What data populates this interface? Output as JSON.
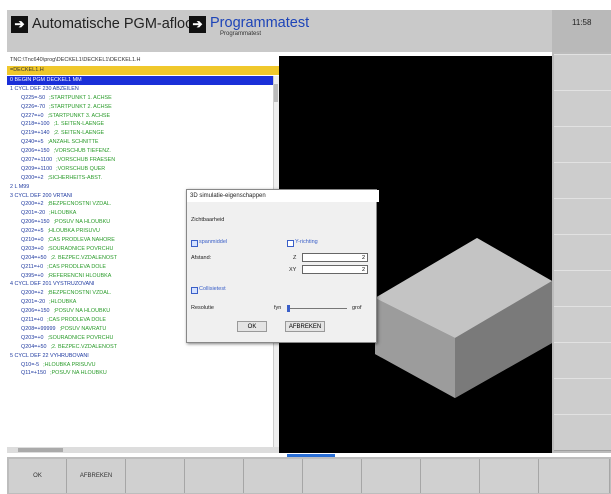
{
  "header": {
    "mode_title": "Automatische PGM-afloop",
    "program_title": "Programmatest",
    "program_sub": "Programmatest",
    "mode_icon": "play-arrow-icon",
    "program_icon": "play-arrow-icon",
    "time": "11:58"
  },
  "program": {
    "path": "TNC:\\Tnc640\\prog\\DECKEL1\\DECKEL1\\DECKEL1.H",
    "file_tab": "=DECKEL1.H",
    "lines": [
      {
        "num": "0",
        "text": "BEGIN PGM DECKEL1 MM",
        "hl": true
      },
      {
        "num": "1",
        "text": "CYCL DEF 230 ABZEILEN"
      },
      {
        "prm": "Q225=-50",
        "cmt": ";STARTPUNKT 1. ACHSE"
      },
      {
        "prm": "Q226=-70",
        "cmt": ";STARTPUNKT 2. ACHSE"
      },
      {
        "prm": "Q227=+0",
        "cmt": ";STARTPUNKT 3. ACHSE"
      },
      {
        "prm": "Q218=+100",
        "cmt": ";1. SEITEN-LAENGE"
      },
      {
        "prm": "Q219=+140",
        "cmt": ";2. SEITEN-LAENGE"
      },
      {
        "prm": "Q240=+5",
        "cmt": ";ANZAHL SCHNITTE"
      },
      {
        "prm": "Q206=+150",
        "cmt": ";VORSCHUB TIEFENZ."
      },
      {
        "prm": "Q207=+1100",
        "cmt": ";VORSCHUB FRAESEN"
      },
      {
        "prm": "Q209=+1100",
        "cmt": ";VORSCHUB QUER"
      },
      {
        "prm": "Q200=+2",
        "cmt": ";SICHERHEITS-ABST."
      },
      {
        "num": "2",
        "text": "L M99"
      },
      {
        "num": "3",
        "text": "CYCL DEF 200 VRTANI"
      },
      {
        "prm": "Q200=+2",
        "cmt": ";BEZPECNOSTNI VZDAL."
      },
      {
        "prm": "Q201=-20",
        "cmt": ";HLOUBKA"
      },
      {
        "prm": "Q206=+150",
        "cmt": ";POSUV NA HLOUBKU"
      },
      {
        "prm": "Q202=+5",
        "cmt": ";HLOUBKA PRISUVU"
      },
      {
        "prm": "Q210=+0",
        "cmt": ";CAS PRODLEVA NAHORE"
      },
      {
        "prm": "Q203=+0",
        "cmt": ";SOURADNICE POVRCHU"
      },
      {
        "prm": "Q204=+50",
        "cmt": ";2. BEZPEC.VZDALENOST"
      },
      {
        "prm": "Q211=+0",
        "cmt": ";CAS PRODLEVA DOLE"
      },
      {
        "prm": "Q395=+0",
        "cmt": ";REFERENCNI HLOUBKA"
      },
      {
        "num": "4",
        "text": "CYCL DEF 201 VYSTRUZOVANI"
      },
      {
        "prm": "Q200=+2",
        "cmt": ";BEZPECNOSTNI VZDAL."
      },
      {
        "prm": "Q201=-20",
        "cmt": ";HLOUBKA"
      },
      {
        "prm": "Q206=+150",
        "cmt": ";POSUV NA HLOUBKU"
      },
      {
        "prm": "Q211=+0",
        "cmt": ";CAS PRODLEVA DOLE"
      },
      {
        "prm": "Q208=+99999",
        "cmt": ";POSUV NAVRATU"
      },
      {
        "prm": "Q203=+0",
        "cmt": ";SOURADNICE POVRCHU"
      },
      {
        "prm": "Q204=+50",
        "cmt": ";2. BEZPEC.VZDALENOST"
      },
      {
        "num": "5",
        "text": "CYCL DEF 22 VYHRUBOVANI"
      },
      {
        "prm": "Q10=-5",
        "cmt": ";HLOUBKA PRISUVU"
      },
      {
        "prm": "Q11=+150",
        "cmt": ";POSUV NA HLOUBKU"
      }
    ]
  },
  "dialog": {
    "title": "3D simulatie-eigenschappen",
    "section": "Zichtbaarheid",
    "chk_clamping": "spanmiddel",
    "chk_clamping_checked": true,
    "chk_yrichting": "Y-richting",
    "chk_yrichting_checked": false,
    "distance_label": "Afstand:",
    "z_label": "Z",
    "z_value": "2",
    "xy_label": "XY",
    "xy_value": "2",
    "chk_collision": "Collisietest",
    "chk_collision_checked": true,
    "resolution_label": "Resolutie",
    "fine_label": "fyn",
    "coarse_label": "grof",
    "resolution_level": 0,
    "ok_label": "OK",
    "cancel_label": "AFBREKEN"
  },
  "softkeys": [
    "OK",
    "AFBREKEN",
    "",
    "",
    "",
    "",
    "",
    "",
    "",
    ""
  ],
  "colors": {
    "accent": "#1d44b8",
    "highlight": "#1a2fd8",
    "tab_yellow": "#f0c82c",
    "comment_green": "#2a9b2a",
    "view_bg": "#000000"
  }
}
